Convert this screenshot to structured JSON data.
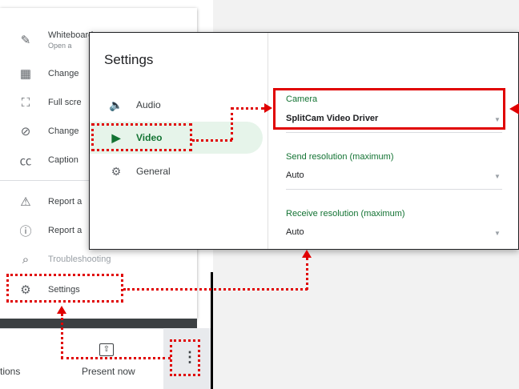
{
  "meet_menu": {
    "items": [
      {
        "icon": "pencil-icon",
        "glyph": "✎",
        "label": "Whiteboard",
        "sub": "Open a"
      },
      {
        "icon": "layout-icon",
        "glyph": "▦",
        "label": "Change"
      },
      {
        "icon": "fullscreen-icon",
        "glyph": "⛶",
        "label": "Full scre"
      },
      {
        "icon": "background-effects-icon",
        "glyph": "⊘",
        "label": "Change"
      },
      {
        "icon": "captions-icon",
        "glyph": "㏄",
        "label": "Caption"
      },
      {
        "icon": "report-feedback-icon",
        "glyph": "⚠",
        "label": "Report a"
      },
      {
        "icon": "report-abuse-icon",
        "glyph": "ⓘ",
        "label": "Report a"
      },
      {
        "icon": "troubleshooting-icon",
        "glyph": "⌕",
        "label": "Troubleshooting"
      },
      {
        "icon": "settings-gear-icon",
        "glyph": "⚙",
        "label": "Settings"
      }
    ]
  },
  "bottom_bar": {
    "activities_label": "tions",
    "present_label": "Present now",
    "present_icon_glyph": "⇧",
    "more_glyph": "⋮"
  },
  "settings": {
    "title": "Settings",
    "nav": [
      {
        "label": "Audio",
        "glyph": "🔈"
      },
      {
        "label": "Video",
        "glyph": "▶"
      },
      {
        "label": "General",
        "glyph": "⚙"
      }
    ],
    "camera_label": "Camera",
    "camera_value": "SplitCam Video Driver",
    "send_label": "Send resolution (maximum)",
    "send_value": "Auto",
    "receive_label": "Receive resolution (maximum)",
    "receive_value": "Auto",
    "caret": "▼"
  },
  "colors": {
    "accent_green": "#137333",
    "active_bg": "#e6f4ea",
    "annotation_red": "#e00000"
  }
}
